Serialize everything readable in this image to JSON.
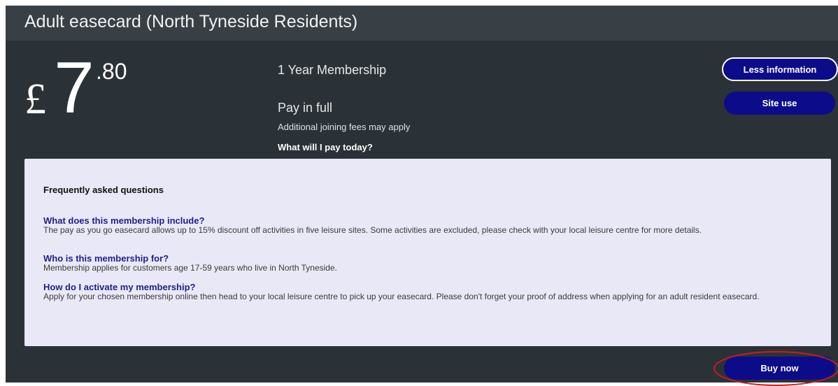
{
  "card": {
    "title": "Adult easecard (North Tyneside Residents)"
  },
  "price": {
    "currency": "£",
    "whole": "7",
    "cents": ".80"
  },
  "plan": {
    "name": "1 Year Membership",
    "pay_mode": "Pay in full",
    "fees_note": "Additional joining fees may apply",
    "pay_today": "What will I pay today?"
  },
  "buttons": {
    "less_information": "Less information",
    "site_use": "Site use",
    "buy_now": "Buy now"
  },
  "faq": {
    "heading": "Frequently asked questions",
    "items": [
      {
        "question": "What does this membership include?",
        "answer": "The pay as you go easecard allows up to 15% discount off activities in five leisure sites. Some activities are excluded, please check with your local leisure centre for more details."
      },
      {
        "question": "Who is this membership for?",
        "answer": "Membership applies for customers age 17-59 years who live in North Tyneside."
      },
      {
        "question": "How do I activate my membership?",
        "answer": "Apply for your chosen membership online then head to your local leisure centre to pick up your easecard. Please don't forget your proof of address when applying for an adult resident easecard."
      }
    ]
  },
  "colors": {
    "card_background": "#2b3237",
    "header_background": "#394045",
    "button_background": "#0c0c8a",
    "faq_panel_background": "#e9e8f6",
    "faq_question_color": "#1e1e8f",
    "highlight_ring": "#d01c1c"
  }
}
